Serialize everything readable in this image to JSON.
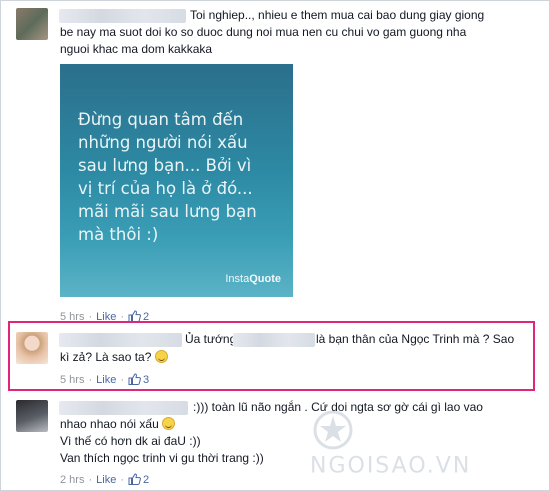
{
  "comments": [
    {
      "lines": [
        "Toi nghiep.., nhieu e them mua cai bao dung giay giong",
        "be nay ma suot doi ko so duoc dung noi mua nen cu chui vo gam guong nha",
        "nguoi khac ma dom kakkaka"
      ],
      "image": {
        "quote": "Đừng quan tâm đến\nnhững người nói xấu\nsau lưng bạn... Bởi vì\nvị trí của họ là ở đó...\nmãi mãi sau lưng bạn\nmà thôi :)",
        "brand_prefix": "Insta",
        "brand_suffix": "Quote"
      },
      "time": "5 hrs",
      "like_label": "Like",
      "likes": "2"
    },
    {
      "line1_prefix": "Ủa tướng",
      "line1_suffix": "là bạn thân của Ngọc Trinh mà ? Sao",
      "line2": "kì zả? Là sao ta?",
      "time": "5 hrs",
      "like_label": "Like",
      "likes": "3",
      "highlight_color": "#e0267a"
    },
    {
      "lines": [
        ":))) toàn lũ não ngắn . Cứ doi ngta sơ gờ cái gì lao vao",
        "nhao nhao nói xấu",
        "Vì thế có hơn dk ai đaU :))",
        "Van thích ngọc trinh vi gu thời trang :))"
      ],
      "time": "2 hrs",
      "like_label": "Like",
      "likes": "2"
    }
  ],
  "watermark": "NGOISAO.VN"
}
